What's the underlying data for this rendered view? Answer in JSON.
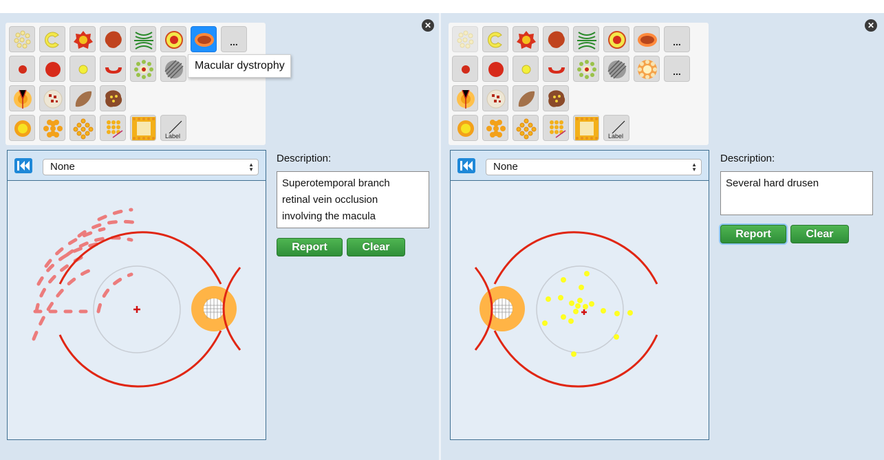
{
  "tooltip": "Macular dystrophy",
  "toolbar": {
    "more_label": "...",
    "label_tool": "Label",
    "close_glyph": "✕"
  },
  "icons": [
    "drusen-icon",
    "crescent-icon",
    "haemorrhage-icon",
    "retinal-haemorrhage-icon",
    "striae-icon",
    "macular-hole-icon",
    "macular-dystrophy-icon",
    "microaneurysm-icon",
    "blot-haemorrhage-icon",
    "hard-exudate-icon",
    "cotton-wool-spot-icon",
    "choroidal-nevus-icon",
    "pigmentation-icon",
    "cnv-icon",
    "vitreous-haemorrhage-icon",
    "circinate-icon",
    "pigment-scar-icon",
    "laser-spot-icon",
    "prp-icon",
    "focal-laser-icon",
    "grid-laser-icon",
    "macular-grid-icon",
    "label-icon",
    "rewind-icon",
    "fovea-icon",
    "optic-disc-icon",
    "temporal-arcade-icon",
    "bvo-haemorrhage-icon"
  ],
  "colors": {
    "vessel": "#e02613",
    "disc": "#ffb446",
    "haemorrhage": "#ec7c7c",
    "drusen": "#ffff22",
    "fovea_marker": "#d11111",
    "button_green": "#3a9f41",
    "selected": "#1e90ff"
  },
  "left": {
    "description_label": "Description:",
    "select_value": "None",
    "description": [
      "Superotemporal branch",
      "retinal vein occlusion",
      "involving the macula"
    ],
    "report_label": "Report",
    "clear_label": "Clear"
  },
  "right": {
    "description_label": "Description:",
    "select_value": "None",
    "description": [
      "Several hard drusen"
    ],
    "report_label": "Report",
    "clear_label": "Clear"
  }
}
